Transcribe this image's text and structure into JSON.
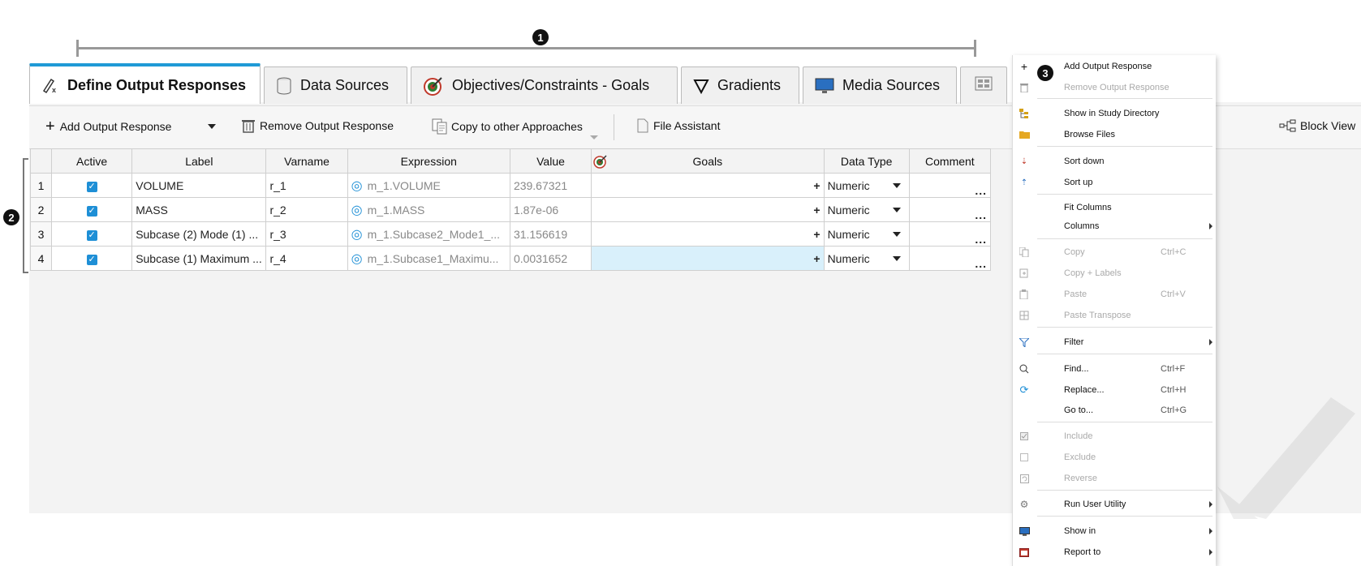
{
  "callouts": {
    "one": "1",
    "two": "2",
    "three": "3"
  },
  "tabs": [
    {
      "label": "Define Output Responses",
      "icon": "define-output-icon",
      "active": true
    },
    {
      "label": "Data Sources",
      "icon": "database-icon"
    },
    {
      "label": "Objectives/Constraints - Goals",
      "icon": "target-icon"
    },
    {
      "label": "Gradients",
      "icon": "nabla-icon"
    },
    {
      "label": "Media Sources",
      "icon": "monitor-icon"
    }
  ],
  "toolbar": {
    "add_label": "Add Output Response",
    "remove_label": "Remove Output Response",
    "copy_label": "Copy to other Approaches",
    "file_assistant_label": "File Assistant",
    "block_view_label": "Block View"
  },
  "table": {
    "headers": {
      "active": "Active",
      "label": "Label",
      "varname": "Varname",
      "expression": "Expression",
      "value": "Value",
      "goals": "Goals",
      "data_type": "Data Type",
      "comment": "Comment"
    },
    "rows": [
      {
        "num": "1",
        "label": "VOLUME",
        "varname": "r_1",
        "expression": "m_1.VOLUME",
        "value": "239.67321",
        "goals": "+",
        "data_type": "Numeric",
        "comment": "..."
      },
      {
        "num": "2",
        "label": "MASS",
        "varname": "r_2",
        "expression": "m_1.MASS",
        "value": "1.87e-06",
        "goals": "+",
        "data_type": "Numeric",
        "comment": "..."
      },
      {
        "num": "3",
        "label": "Subcase (2) Mode (1) ...",
        "varname": "r_3",
        "expression": "m_1.Subcase2_Mode1_...",
        "value": "31.156619",
        "goals": "+",
        "data_type": "Numeric",
        "comment": "..."
      },
      {
        "num": "4",
        "label": "Subcase (1) Maximum ...",
        "varname": "r_4",
        "expression": "m_1.Subcase1_Maximu...",
        "value": "0.0031652",
        "goals": "+",
        "data_type": "Numeric",
        "comment": "..."
      }
    ]
  },
  "menu": {
    "add": "Add Output Response",
    "remove": "Remove Output Response",
    "show_study": "Show in Study Directory",
    "browse": "Browse Files",
    "sort_down": "Sort down",
    "sort_up": "Sort up",
    "fit_columns": "Fit Columns",
    "columns": "Columns",
    "copy": "Copy",
    "copy_sc": "Ctrl+C",
    "copy_labels": "Copy + Labels",
    "paste": "Paste",
    "paste_sc": "Ctrl+V",
    "paste_transpose": "Paste Transpose",
    "filter": "Filter",
    "find": "Find...",
    "find_sc": "Ctrl+F",
    "replace": "Replace...",
    "replace_sc": "Ctrl+H",
    "goto": "Go to...",
    "goto_sc": "Ctrl+G",
    "include": "Include",
    "exclude": "Exclude",
    "reverse": "Reverse",
    "run_user_utility": "Run User Utility",
    "show_in": "Show in",
    "report_to": "Report to"
  }
}
